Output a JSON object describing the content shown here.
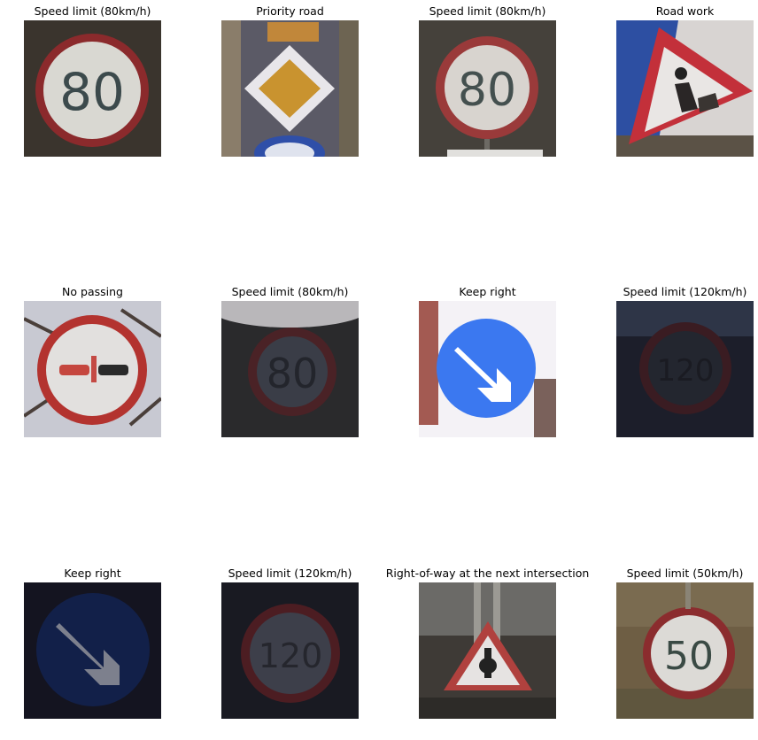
{
  "figure": {
    "cells": [
      {
        "title": "Speed limit (80km/h)",
        "icon": "speed-limit-80-sign"
      },
      {
        "title": "Priority road",
        "icon": "priority-road-sign"
      },
      {
        "title": "Speed limit (80km/h)",
        "icon": "speed-limit-80-sign"
      },
      {
        "title": "Road work",
        "icon": "road-work-sign"
      },
      {
        "title": "No passing",
        "icon": "no-passing-sign"
      },
      {
        "title": "Speed limit (80km/h)",
        "icon": "speed-limit-80-sign"
      },
      {
        "title": "Keep right",
        "icon": "keep-right-sign"
      },
      {
        "title": "Speed limit (120km/h)",
        "icon": "speed-limit-120-sign"
      },
      {
        "title": "Keep right",
        "icon": "keep-right-sign"
      },
      {
        "title": "Speed limit (120km/h)",
        "icon": "speed-limit-120-sign"
      },
      {
        "title": "Right-of-way at the next intersection",
        "icon": "right-of-way-sign"
      },
      {
        "title": "Speed limit (50km/h)",
        "icon": "speed-limit-50-sign"
      }
    ]
  }
}
